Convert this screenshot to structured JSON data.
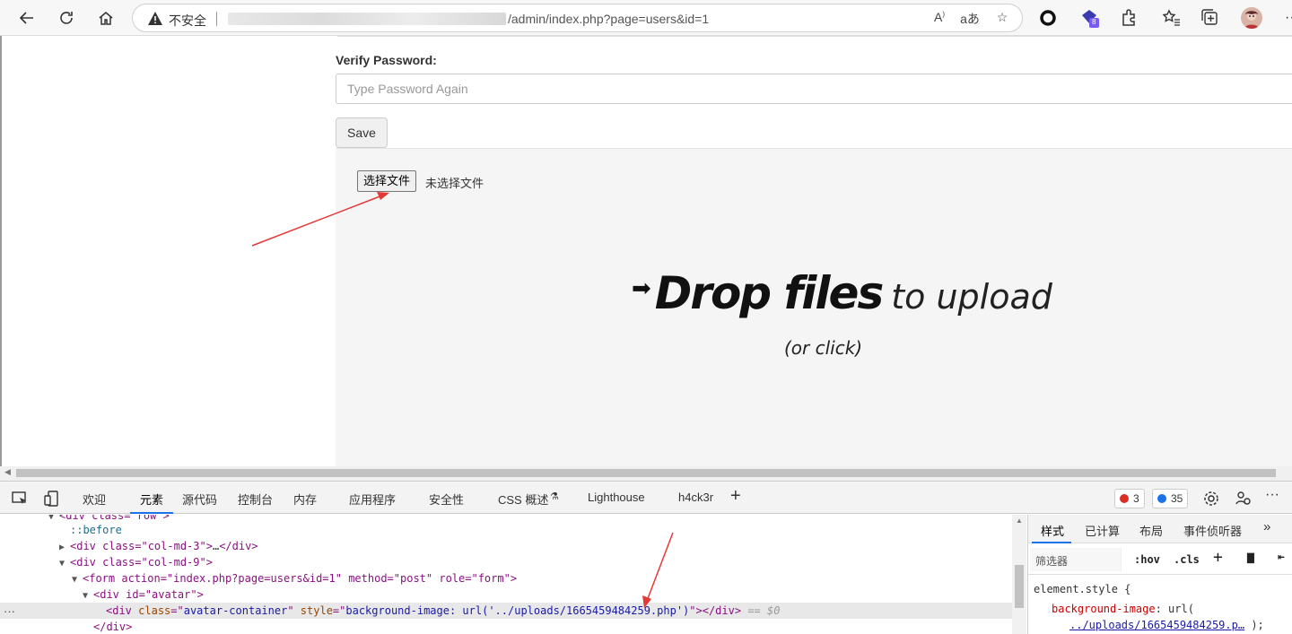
{
  "browser": {
    "insecure_label": "不安全",
    "url_visible": "/admin/index.php?page=users&id=1",
    "extension_badge": "8"
  },
  "form": {
    "verify_label": "Verify Password:",
    "verify_placeholder": "Type Password Again",
    "save_label": "Save"
  },
  "upload": {
    "choose_file_label": "选择文件",
    "no_file_label": "未选择文件",
    "drop_strong": "Drop files",
    "drop_light": "to upload",
    "drop_sub": "(or click)"
  },
  "devtools": {
    "tabs": [
      "欢迎",
      "元素",
      "源代码",
      "控制台",
      "内存",
      "应用程序",
      "安全性",
      "CSS 概述",
      "Lighthouse",
      "h4ck3r"
    ],
    "active_tab": "元素",
    "error_count": "3",
    "message_count": "35",
    "dom": {
      "line0": "<div class=\"row\">",
      "line1": "::before",
      "line2_open": "<div class=\"col-md-3\">",
      "line2_ellip": "…",
      "line2_close": "</div>",
      "line3": "<div class=\"col-md-9\">",
      "line4": "<form action=\"index.php?page=users&id=1\" method=\"post\" role=\"form\">",
      "line5": "<div id=\"avatar\">",
      "line6_tag": "div",
      "line6_class": "avatar-container",
      "line6_style": "background-image: url('../uploads/1665459484259.php')",
      "line6_suffix": "== $0",
      "line7": "</div>"
    },
    "styles": {
      "tabs": [
        "样式",
        "已计算",
        "布局",
        "事件侦听器"
      ],
      "filter_placeholder": "筛选器",
      "hov": ":hov",
      "cls": ".cls",
      "selector": "element.style {",
      "prop": "background-image",
      "value_prefix": "url(",
      "value_link": "../uploads/1665459484259.p…",
      "value_suffix": ");"
    }
  }
}
